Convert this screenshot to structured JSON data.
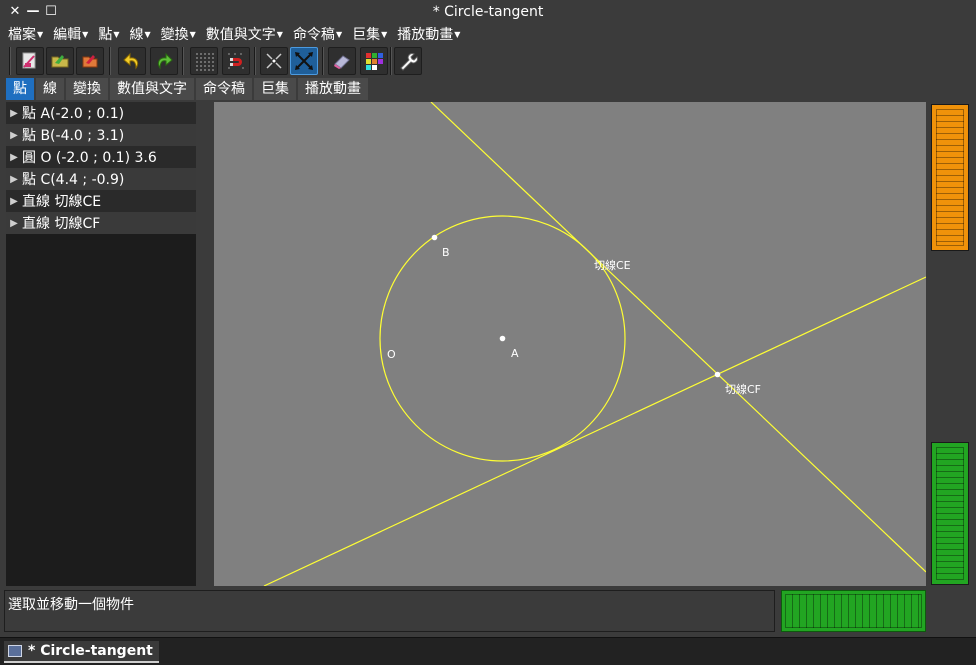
{
  "window": {
    "title": "* Circle-tangent",
    "close_glyph": "✕",
    "minimize_glyph": "—",
    "maximize_glyph": "☐"
  },
  "menus": [
    {
      "label": "檔案"
    },
    {
      "label": "編輯"
    },
    {
      "label": "點"
    },
    {
      "label": "線"
    },
    {
      "label": "變換"
    },
    {
      "label": "數值與文字"
    },
    {
      "label": "命令稿"
    },
    {
      "label": "巨集"
    },
    {
      "label": "播放動畫"
    }
  ],
  "menu_arrow": "▼",
  "toolbar_icons": [
    "new-file-icon",
    "open-folder-icon",
    "export-icon",
    "undo-icon",
    "redo-icon",
    "grid-icon",
    "magnet-icon",
    "move-points-icon",
    "move-selection-icon",
    "eraser-icon",
    "color-palette-icon",
    "wrench-icon"
  ],
  "tabs": [
    {
      "label": "點",
      "active": true
    },
    {
      "label": "線"
    },
    {
      "label": "變換"
    },
    {
      "label": "數值與文字"
    },
    {
      "label": "命令稿"
    },
    {
      "label": "巨集"
    },
    {
      "label": "播放動畫"
    }
  ],
  "objects": [
    {
      "text": "點 A(-2.0 ; 0.1)"
    },
    {
      "text": "點 B(-4.0 ; 3.1)"
    },
    {
      "text": "圓 O (-2.0 ; 0.1) 3.6"
    },
    {
      "text": "點 C(4.4 ; -0.9)"
    },
    {
      "text": "直線 切線CE"
    },
    {
      "text": "直線 切線CF"
    }
  ],
  "expand_glyph": "▶",
  "canvas": {
    "labels": {
      "A": "A",
      "B": "B",
      "O": "O",
      "CE": "切線CE",
      "CF": "切線CF"
    },
    "colors": {
      "background": "#808080",
      "lines": "#ffff33",
      "points": "#ffffff"
    }
  },
  "status": {
    "message": "選取並移動一個物件"
  },
  "taskbar": {
    "task_label": "* Circle-tangent"
  },
  "colors": {
    "accent": "#1f6fc0",
    "orange_panel": "#f0920a",
    "green_panel": "#22a522"
  }
}
